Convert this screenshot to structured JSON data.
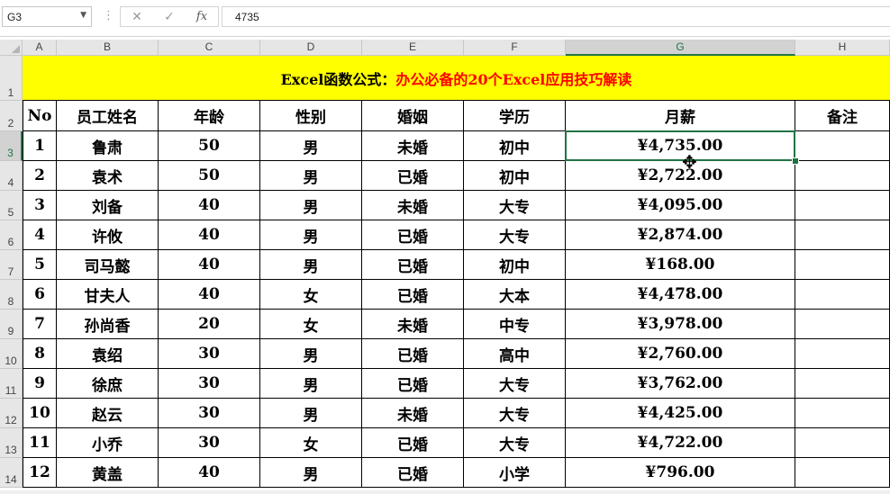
{
  "formula_bar": {
    "name_box": "G3",
    "cancel_glyph": "✕",
    "enter_glyph": "✓",
    "fx_glyph": "fx",
    "value": "4735"
  },
  "columns": [
    "A",
    "B",
    "C",
    "D",
    "E",
    "F",
    "G",
    "H"
  ],
  "rows": [
    "1",
    "2",
    "3",
    "4",
    "5",
    "6",
    "7",
    "8",
    "9",
    "10",
    "11",
    "12",
    "13",
    "14"
  ],
  "title": {
    "part1": "Excel函数公式：",
    "part2": "办公必备的20个Excel应用技巧解读"
  },
  "headers": [
    "No",
    "员工姓名",
    "年龄",
    "性别",
    "婚姻",
    "学历",
    "月薪",
    "备注"
  ],
  "records": [
    [
      "1",
      "鲁肃",
      "50",
      "男",
      "未婚",
      "初中",
      "¥4,735.00",
      ""
    ],
    [
      "2",
      "袁术",
      "50",
      "男",
      "已婚",
      "初中",
      "¥2,722.00",
      ""
    ],
    [
      "3",
      "刘备",
      "40",
      "男",
      "未婚",
      "大专",
      "¥4,095.00",
      ""
    ],
    [
      "4",
      "许攸",
      "40",
      "男",
      "已婚",
      "大专",
      "¥2,874.00",
      ""
    ],
    [
      "5",
      "司马懿",
      "40",
      "男",
      "已婚",
      "初中",
      "¥168.00",
      ""
    ],
    [
      "6",
      "甘夫人",
      "40",
      "女",
      "已婚",
      "大本",
      "¥4,478.00",
      ""
    ],
    [
      "7",
      "孙尚香",
      "20",
      "女",
      "未婚",
      "中专",
      "¥3,978.00",
      ""
    ],
    [
      "8",
      "袁绍",
      "30",
      "男",
      "已婚",
      "高中",
      "¥2,760.00",
      ""
    ],
    [
      "9",
      "徐庶",
      "30",
      "男",
      "已婚",
      "大专",
      "¥3,762.00",
      ""
    ],
    [
      "10",
      "赵云",
      "30",
      "男",
      "未婚",
      "大专",
      "¥4,425.00",
      ""
    ],
    [
      "11",
      "小乔",
      "30",
      "女",
      "已婚",
      "大专",
      "¥4,722.00",
      ""
    ],
    [
      "12",
      "黄盖",
      "40",
      "男",
      "已婚",
      "小学",
      "¥796.00",
      ""
    ]
  ],
  "selected": {
    "col": "G",
    "row": "3"
  },
  "colors": {
    "accent": "#217346",
    "title_bg": "#ffff00",
    "title_red": "#ff0000"
  }
}
